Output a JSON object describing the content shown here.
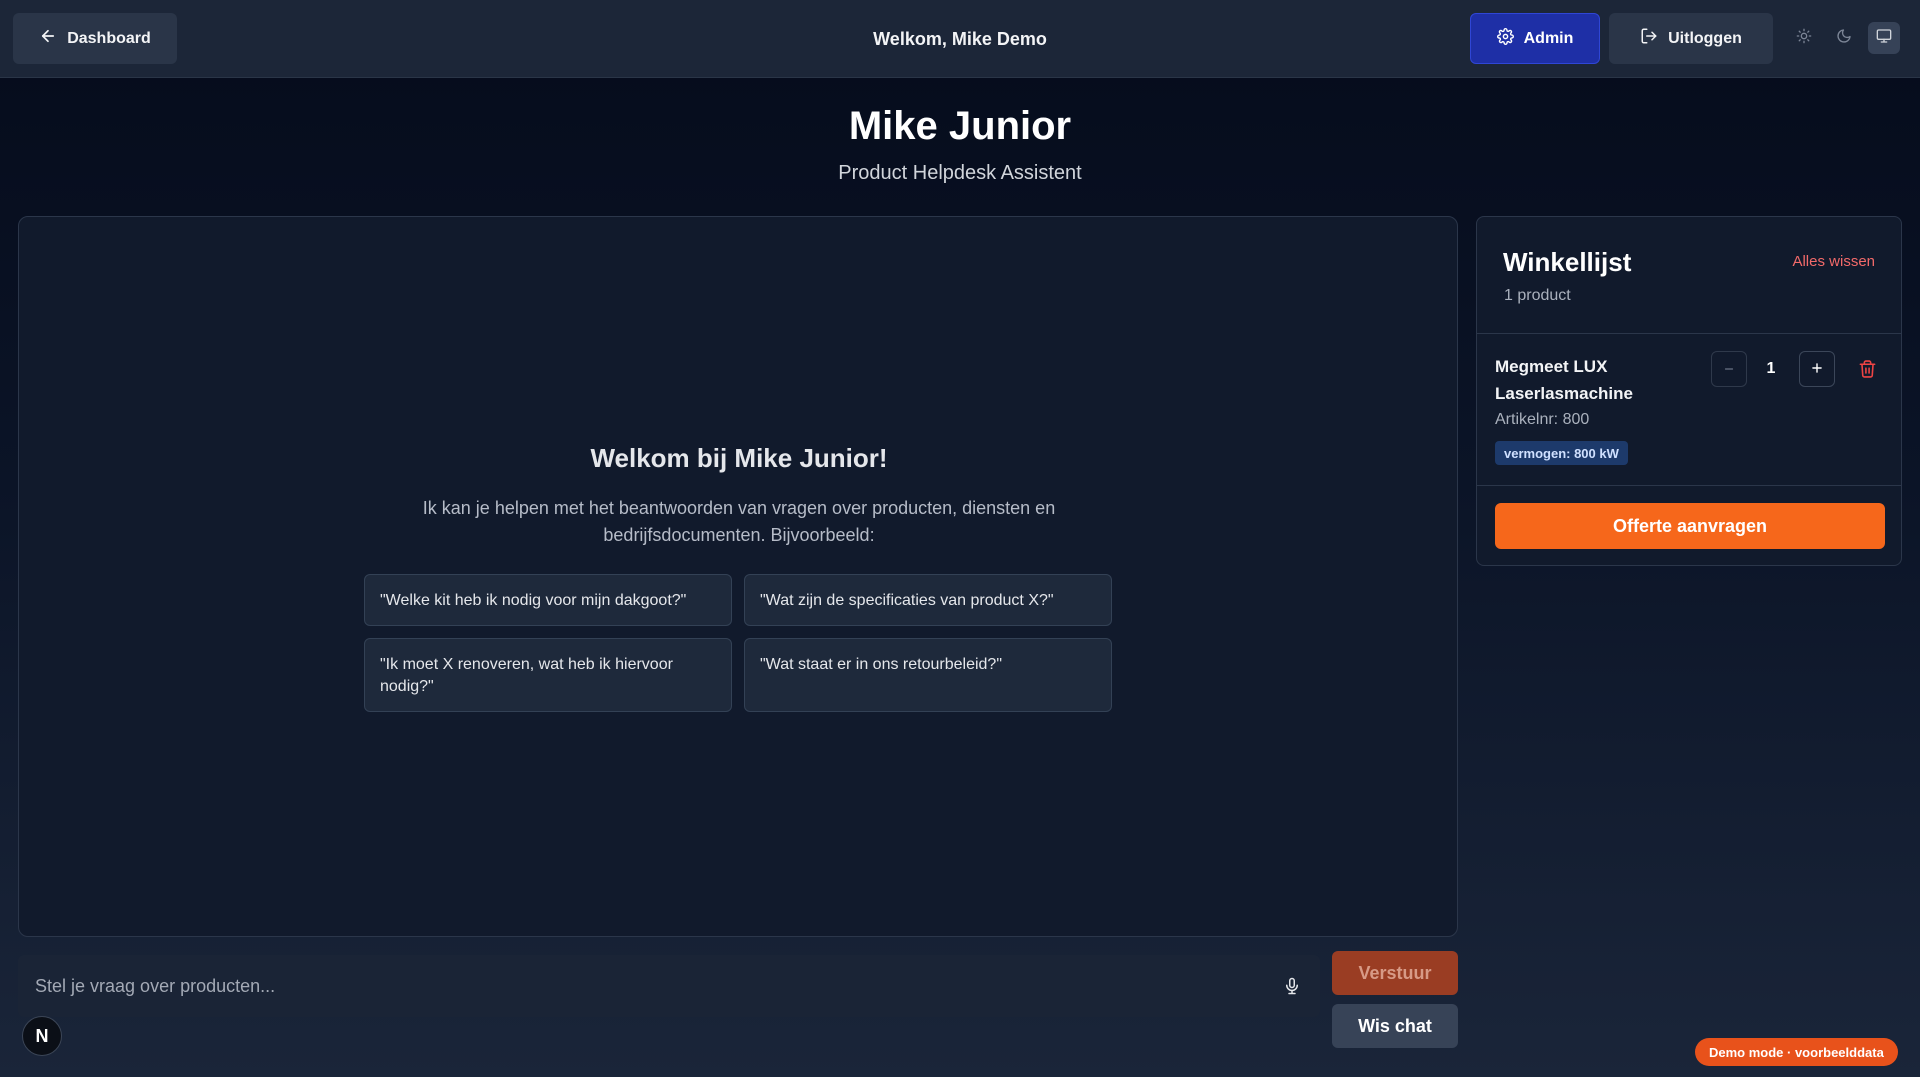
{
  "header": {
    "back_label": "Dashboard",
    "welcome": "Welkom, Mike Demo",
    "admin_label": "Admin",
    "logout_label": "Uitloggen"
  },
  "page": {
    "title": "Mike Junior",
    "subtitle": "Product Helpdesk Assistent"
  },
  "chat": {
    "welcome_title": "Welkom bij Mike Junior!",
    "intro": "Ik kan je helpen met het beantwoorden van vragen over producten, diensten en bedrijfsdocumenten. Bijvoorbeeld:",
    "suggestions": [
      "\"Welke kit heb ik nodig voor mijn dakgoot?\"",
      "\"Wat zijn de specificaties van product X?\"",
      "\"Ik moet X renoveren, wat heb ik hiervoor nodig?\"",
      "\"Wat staat er in ons retourbeleid?\""
    ],
    "input_placeholder": "Stel je vraag over producten...",
    "send_label": "Verstuur",
    "clear_label": "Wis chat"
  },
  "cart": {
    "title": "Winkellijst",
    "count": "1 product",
    "clear_all": "Alles wissen",
    "item": {
      "name": "Megmeet LUX Laserlasmachine",
      "article": "Artikelnr: 800",
      "tag": "vermogen: 800 kW",
      "quantity": "1"
    },
    "request_quote": "Offerte aanvragen"
  },
  "footer": {
    "badge_letter": "N",
    "demo_mode": "Demo mode · voorbeelddata"
  },
  "colors": {
    "accent_orange": "#f6671b",
    "admin_blue": "#1e2fa6",
    "danger_red": "#f26a6a"
  },
  "icons": {
    "back": "arrow-left-icon",
    "admin": "gear-icon",
    "logout": "logout-icon",
    "light": "sun-icon",
    "dark": "moon-icon",
    "system": "monitor-icon",
    "mic": "microphone-icon",
    "delete": "trash-icon"
  }
}
